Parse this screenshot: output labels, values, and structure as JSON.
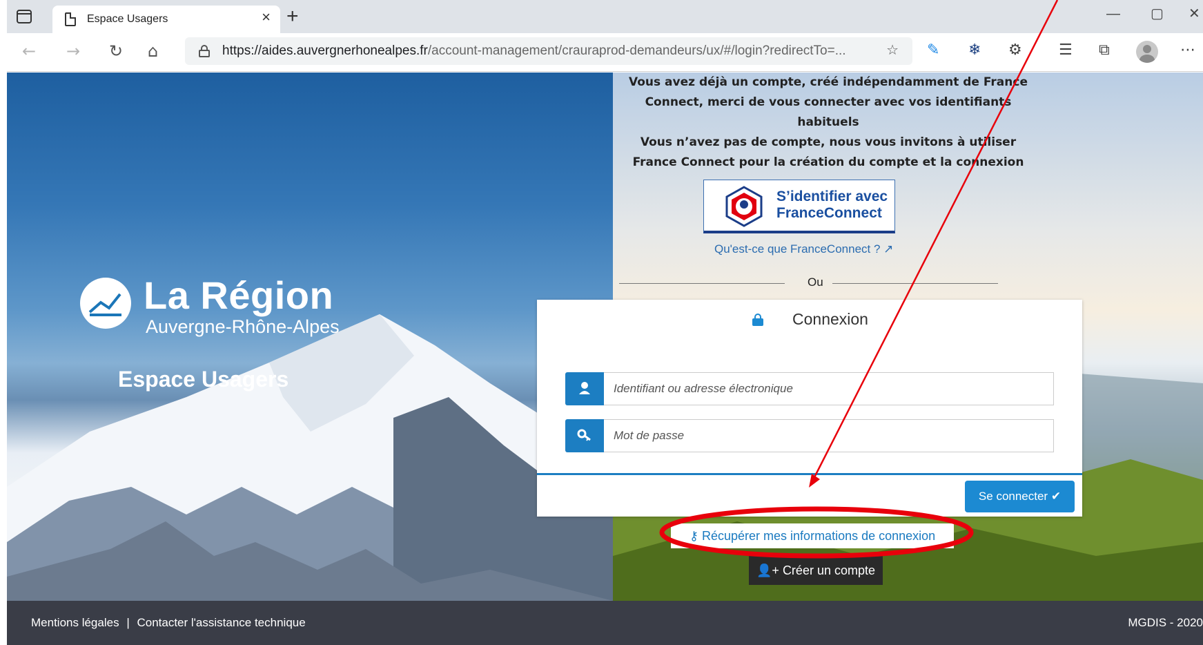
{
  "browser": {
    "tab_title": "Espace Usagers",
    "tab_close": "×",
    "new_tab": "+",
    "url_host": "https://aides.auvergnerhonealpes.fr",
    "url_path": "/account-management/crauraprod-demandeurs/ux/#/login?redirectTo=...",
    "window_controls": [
      "—",
      "▢",
      "✕"
    ]
  },
  "branding": {
    "logo_title": "La Région",
    "logo_subtitle": "Auvergne-Rhône-Alpes",
    "space_title": "Espace Usagers"
  },
  "info": {
    "lines": [
      "Vous avez déjà un compte, créé indépendamment de France",
      "Connect, merci de vous connecter avec vos identifiants",
      "habituels",
      "Vous n’avez pas de compte, nous vous invitons à utiliser",
      "France Connect pour la création du compte et la connexion"
    ]
  },
  "franceconnect": {
    "button_line1": "S’identifier avec",
    "button_line2": "FranceConnect",
    "what_is": "Qu'est-ce que FranceConnect ?",
    "or": "Ou"
  },
  "login": {
    "title": "Connexion",
    "username_placeholder": "Identifiant ou adresse électronique",
    "password_placeholder": "Mot de passe",
    "submit": "Se connecter ✔",
    "recover": "Récupérer mes informations de connexion",
    "create": "Créer un compte"
  },
  "footer": {
    "legal": "Mentions légales",
    "separator": "|",
    "support": "Contacter l'assistance technique",
    "right": "MGDIS - 2020"
  },
  "colors": {
    "accent": "#1c8ad2",
    "annotation": "#e8000b",
    "footer_bg": "#3a3d47"
  }
}
